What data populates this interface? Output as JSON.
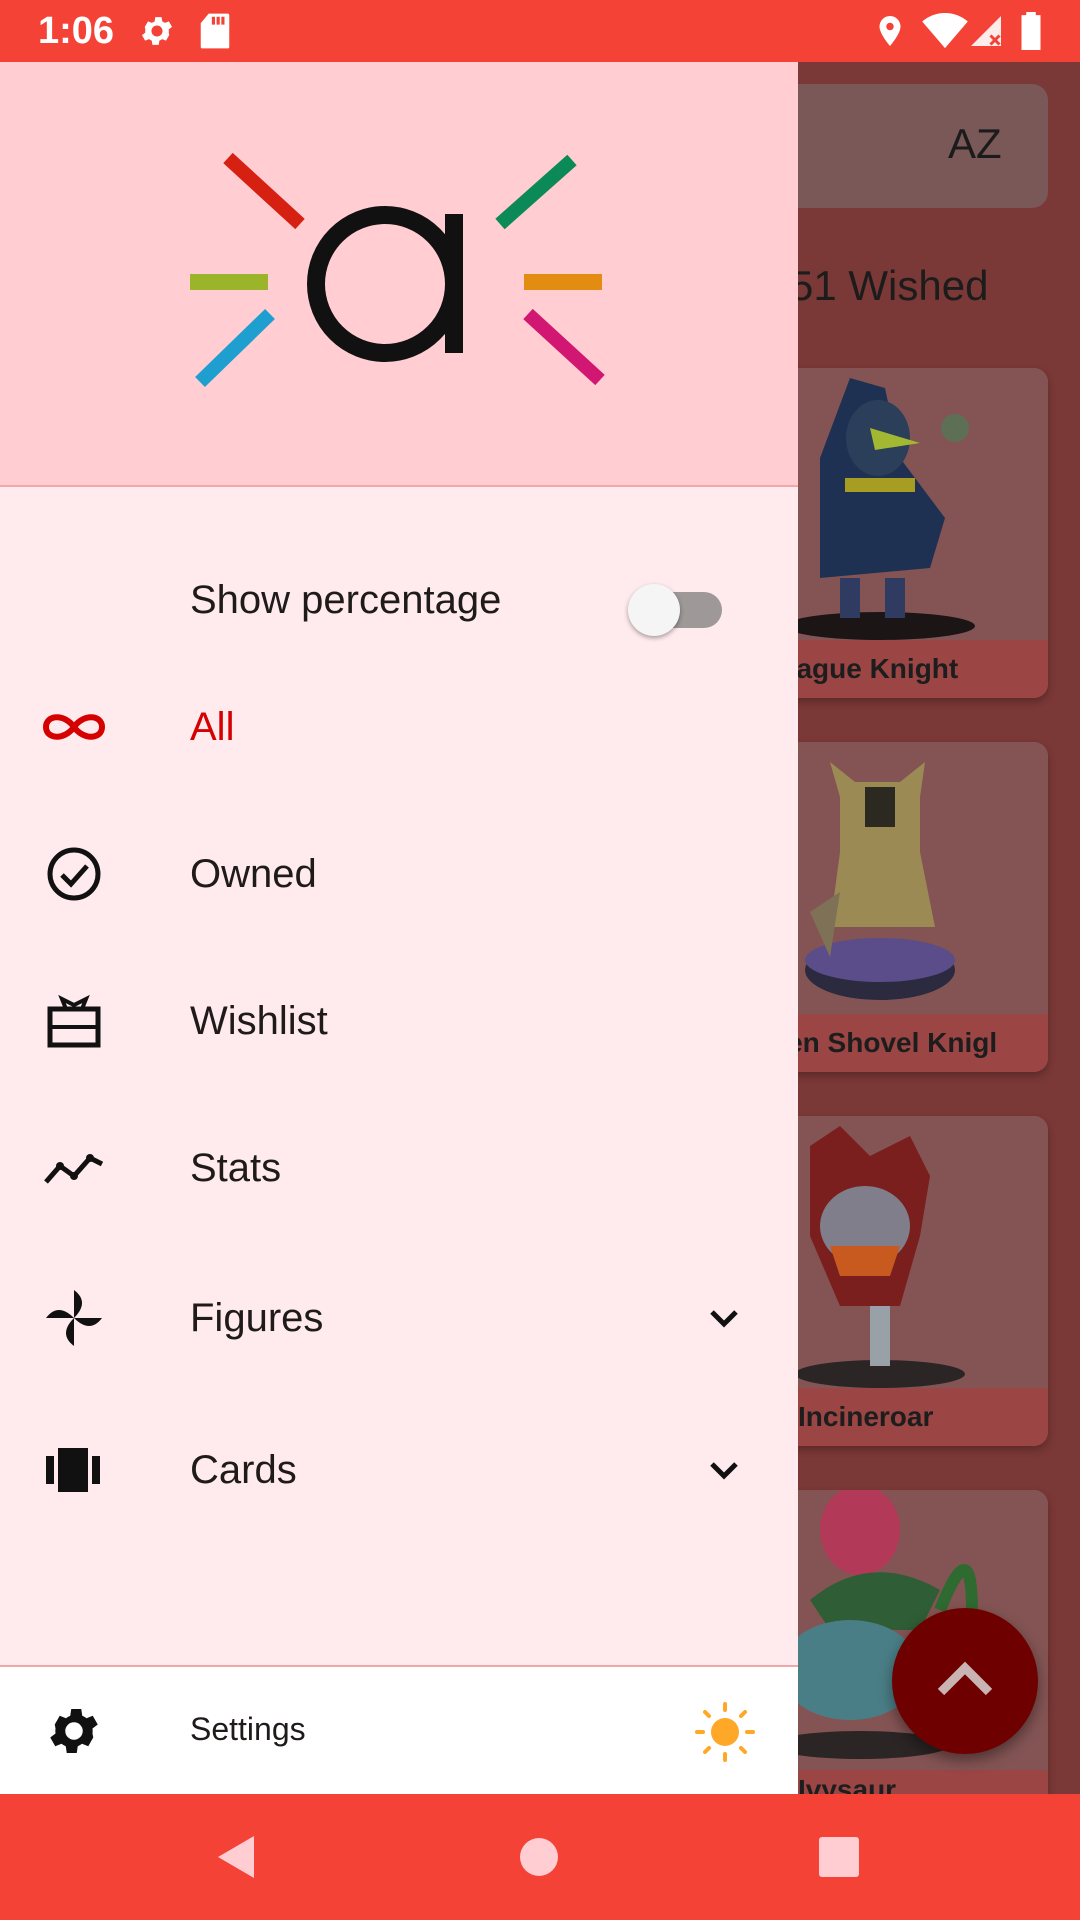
{
  "status_bar": {
    "time": "1:06",
    "icons": [
      "settings-icon",
      "sd-card-icon",
      "location-icon",
      "wifi-icon",
      "signal-icon",
      "battery-icon"
    ]
  },
  "background": {
    "sort_icon_text": "AZ",
    "count_text": "51 Wished",
    "cards": [
      {
        "name": "Plague Knight"
      },
      {
        "name": "den Shovel Knigl"
      },
      {
        "name": "Incineroar"
      },
      {
        "name": "Ivysaur"
      }
    ]
  },
  "drawer": {
    "show_percentage": {
      "label": "Show percentage",
      "enabled": false
    },
    "items": [
      {
        "label": "All",
        "icon": "infinity-icon",
        "active": true
      },
      {
        "label": "Owned",
        "icon": "check-circle-icon",
        "active": false
      },
      {
        "label": "Wishlist",
        "icon": "gift-card-icon",
        "active": false
      },
      {
        "label": "Stats",
        "icon": "stats-line-icon",
        "active": false
      },
      {
        "label": "Figures",
        "icon": "pinwheel-icon",
        "expandable": true
      },
      {
        "label": "Cards",
        "icon": "cards-icon",
        "expandable": true
      }
    ],
    "footer": {
      "label": "Settings",
      "theme_icon": "sun-icon"
    }
  },
  "colors": {
    "accent": "#d50000",
    "primary": "#f44336",
    "drawer_bg": "#ffebee",
    "header_bg": "#ffcdd2",
    "sun": "#ffa726"
  }
}
